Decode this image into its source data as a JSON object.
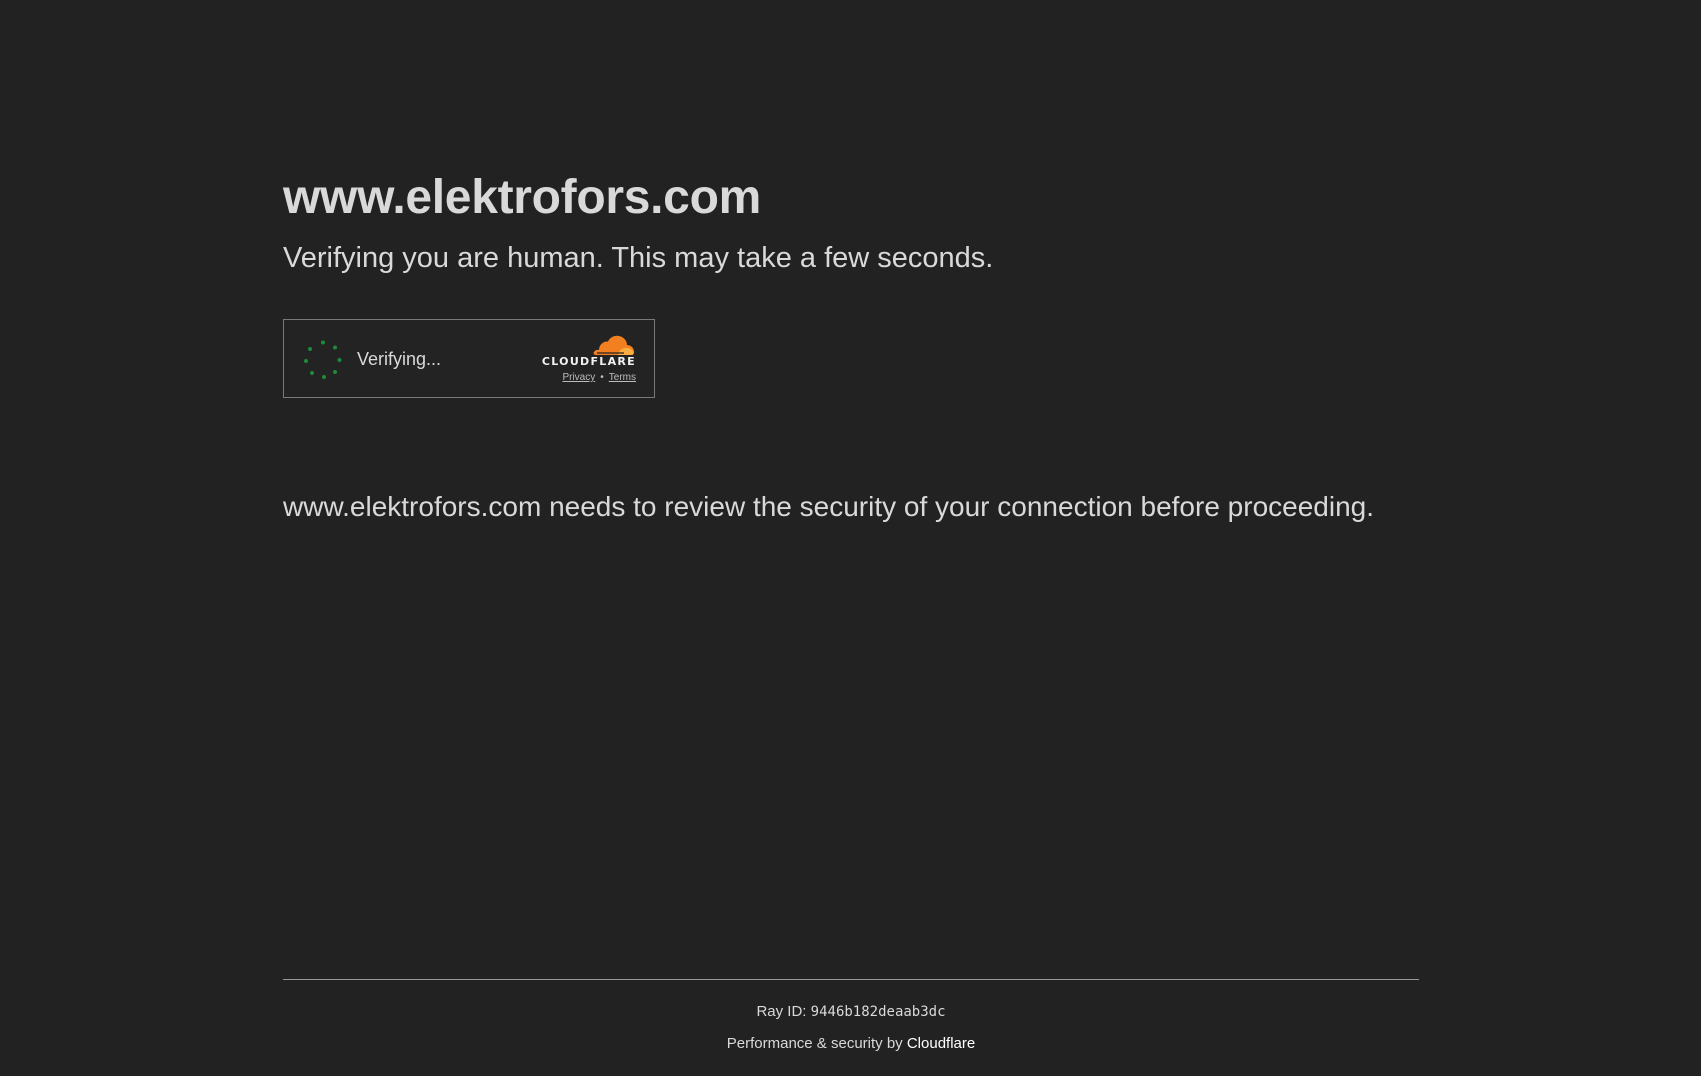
{
  "header": {
    "site_title": "www.elektrofors.com",
    "subtitle": "Verifying you are human. This may take a few seconds."
  },
  "widget": {
    "status_text": "Verifying...",
    "brand_wordmark": "CLOUDFLARE",
    "privacy_label": "Privacy",
    "separator": "•",
    "terms_label": "Terms",
    "spinner_color": "#1e8b3a",
    "brand_color": "#f38020"
  },
  "main": {
    "security_message": "www.elektrofors.com needs to review the security of your connection before proceeding."
  },
  "footer": {
    "ray_label": "Ray ID: ",
    "ray_value": "9446b182deaab3dc",
    "perf_prefix": "Performance & security by ",
    "perf_link": "Cloudflare"
  },
  "colors": {
    "background": "#222222",
    "text": "#d9d9d9"
  }
}
